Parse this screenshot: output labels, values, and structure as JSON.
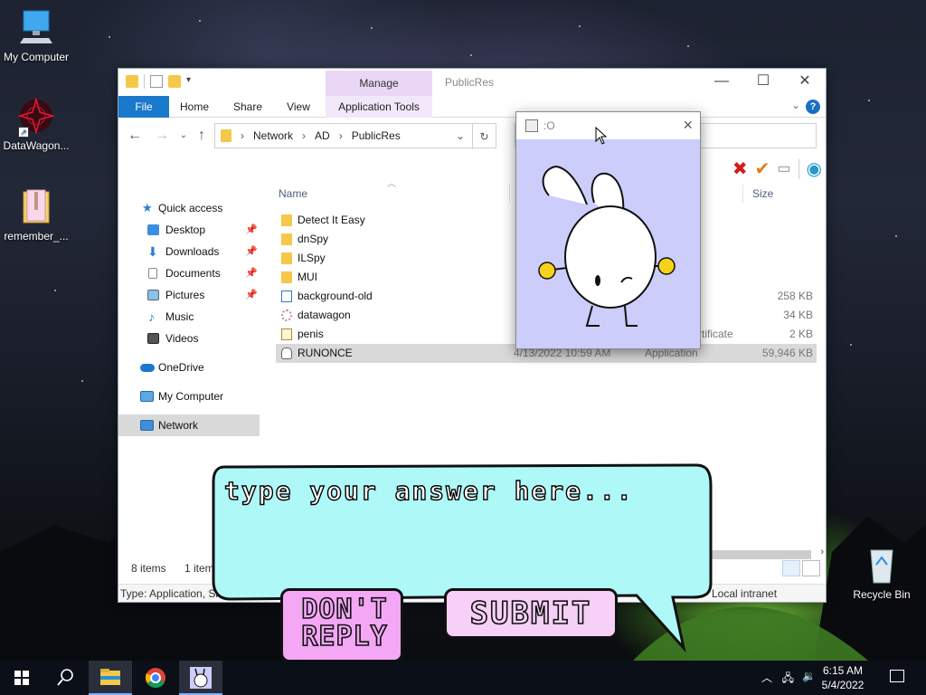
{
  "desktop": {
    "icons": [
      {
        "label": "My Computer"
      },
      {
        "label": "DataWagon..."
      },
      {
        "label": "remember_..."
      },
      {
        "label": "Recycle Bin"
      }
    ]
  },
  "explorer": {
    "context_tab": "Manage",
    "title": "PublicRes",
    "ribbon_tabs": [
      "File",
      "Home",
      "Share",
      "View",
      "Application Tools"
    ],
    "help": "?",
    "address": {
      "parts": [
        "Network",
        "AD",
        "PublicRes"
      ]
    },
    "nav": [
      {
        "label": "Quick access"
      },
      {
        "label": "Desktop",
        "pinned": true
      },
      {
        "label": "Downloads",
        "pinned": true
      },
      {
        "label": "Documents",
        "pinned": true
      },
      {
        "label": "Pictures",
        "pinned": true
      },
      {
        "label": "Music"
      },
      {
        "label": "Videos"
      },
      {
        "label": "OneDrive"
      },
      {
        "label": "My Computer"
      },
      {
        "label": "Network",
        "selected": true
      }
    ],
    "columns": {
      "name": "Name",
      "size": "Size"
    },
    "files": [
      {
        "name": "Detect It Easy",
        "date": "",
        "type": "",
        "size": "",
        "icon": "folder-icon"
      },
      {
        "name": "dnSpy",
        "date": "",
        "type": "",
        "size": "",
        "icon": "folder-icon"
      },
      {
        "name": "ILSpy",
        "date": "",
        "type": "",
        "size": "",
        "icon": "folder-icon"
      },
      {
        "name": "MUI",
        "date": "",
        "type": "",
        "size": "",
        "icon": "folder-icon"
      },
      {
        "name": "background-old",
        "date": "",
        "type": "",
        "size": "258 KB",
        "icon": "image-file-icon"
      },
      {
        "name": "datawagon",
        "date": "",
        "type": "",
        "size": "34 KB",
        "icon": "datawagon-icon"
      },
      {
        "name": "penis",
        "date": "",
        "type": "rtificate",
        "size": "2 KB",
        "icon": "certificate-icon"
      },
      {
        "name": "RUNONCE",
        "date": "4/13/2022 10:59 AM",
        "type": "Application",
        "size": "59,946 KB",
        "icon": "bunny-app-icon"
      }
    ],
    "status": {
      "item_count": "8 items",
      "selected": "1 item",
      "details": "Type: Application, Siz",
      "zone": "Local intranet"
    }
  },
  "popup": {
    "title": ":O"
  },
  "dialog": {
    "prompt": "type your answer here...",
    "dont_reply": "DON'T REPLY",
    "submit": "SUBMIT"
  },
  "taskbar": {
    "time": "6:15 AM",
    "date": "5/4/2022"
  },
  "colors": {
    "bubble": "#aef8f8",
    "dont_reply_button": "#f3a7f5",
    "submit_button": "#f6d0f7",
    "popup_background": "#cdcdfb",
    "ribbon_file_tab": "#1979ca",
    "manage_tab": "#e9d7f5"
  }
}
